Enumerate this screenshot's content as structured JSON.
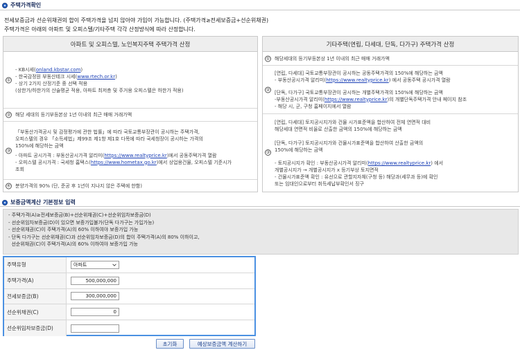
{
  "section1": {
    "title": "주택가격확인",
    "intro_line1": "전세보증금과 선순위채권의 합이 주택가격을 넘지 않아야 가입이 가능합니다. (주택가격≥전세보증금+선순위채권)",
    "intro_line2": "주택가격은 아래의 아파트 및 오피스텔/기타주택 각각 산정방식에 따라 산정합니다."
  },
  "left_panel": {
    "header": "아파트 및 오피스텔, 노인복지주택 주택가격 산정",
    "rows": [
      {
        "num": "①",
        "l1_prefix": "- KB시세(",
        "l1_link": "onland.kbstar.com",
        "l1_suffix": ")",
        "l2_prefix": "- 한국감정원 부동산테크 시세(",
        "l2_link": "www.rtech.or.kr",
        "l2_suffix": ")",
        "l3": "- 상기 2가지 산정기준 중 선택 적용",
        "l4": "(상한가/하한가의 산술평균 적용, 아파트 최저층 및 주거용 오피스텔은 하한가 적용)"
      },
      {
        "num": "②",
        "text": "해당 세대의 등기부등본상 1년 이내의 최근 매매 거래가액"
      },
      {
        "num": "③",
        "l1": "「부동산가격공시 및 감정평가에 관한 법률」에 따라 국토교통부장관이 공시하는 주택가격,",
        "l2": "오피스텔의 경우 「소득세법」제99조 제1항 제1호 다목에 따라 국세청장이 공시하는 가격의",
        "l3": "150%에 해당하는 금액",
        "l4_prefix": "- 아파트 공시가격 : 부동산공시가격 알리미(",
        "l4_link": "https://www.realtyprice.kr",
        "l4_suffix": ")에서 공동주택가격 열람",
        "l5_prefix": "- 오피스텔 공시가격 : 국세청 홈택스(",
        "l5_link": "https://www.hometax.go.kr",
        "l5_suffix": ")에서 상업용건물, 오피스텔 기준시가",
        "l6": "조회"
      },
      {
        "num": "④",
        "text": "분양가격의 90% (단, 준공 후 1년이 지나지 않은 주택에 한함)"
      }
    ]
  },
  "right_panel": {
    "header": "기타주택(연립, 다세대, 단독, 다가구) 주택가격 산정",
    "rows": [
      {
        "num": "①",
        "text": "해당세대의 등기부등본상 1년 이내의 최근 매매 거래가액"
      },
      {
        "num": "②",
        "a1": "[연립, 다세대] 국토교통부장관이 공시하는 공동주택가격의 150%에 해당하는 금액",
        "a2_prefix": "- 부동산공시가격 알리미(",
        "a2_link": "https://www.realtyprice.kr",
        "a2_suffix": ") 에서 공동주택 공시가격 열람",
        "b1": "[단독, 다가구] 국토교통부장관이 공시하는 개별주택가격의 150%에 해당하는 금액",
        "b2_prefix": "-부동산공시가격 알리미(",
        "b2_link": "https://www.realtyprice.kr",
        "b2_suffix": ")의 개별단독주택가격 안내 페이지 참조",
        "b3": "- 해당 시, 군, 구청 홈페이지에서 열람"
      },
      {
        "num": "③",
        "a1": "[연립, 다세대] 토지공시지가와 건물 시가표준액을 합산하여 전체 연면적 대비",
        "a2": "해당세대 연면적 비율로 산출한 금액의 150%에 해당하는 금액",
        "b1": "[단독, 다가구] 토지공시지가와 건물시가표준액을 합산하여 산출한 금액의",
        "b2": "150%에 해당하는 금액",
        "c1_prefix": "- 토지공시지가 확인 : 부동산공시가격 알리미(",
        "c1_link": "https://www.realtyprice.kr",
        "c1_suffix": ") 에서",
        "c2": "개별공시지가 → 개별공시지가 x 등기부상 토지면적",
        "c3": "- 건물시가표준액 확인 : 유선으로 관할지자체(구청 등) 해당과(세무과 등)에 확인",
        "c4": "또는 임대인으로부터 취득세납부확인서 징구"
      }
    ]
  },
  "section2": {
    "title": "보증금액계산 기본정보 입력"
  },
  "info_box": {
    "lines": [
      "- 주택가격(A)≥전세보증금(B)+선순위채권(C)+선순위임차보증금(D)",
      "- 선순위임차보증금(D)이 있으면 보증가입불가(단독 다가구는 가입가능)",
      "- 선순위채권(C)이 주택가격(A)의 60% 이하여야 보증가입 가능",
      "- 단독 다가구는 선순위채권(C)과 선순위임차보증금(D)의 합이 주택가격(A)의 80% 이하이고,",
      "  선순위채권(C)이 주택가격(A)의 60% 이하여야 보증가입 가능"
    ]
  },
  "form": {
    "house_type_label": "주택유형",
    "house_type_value": "아파트",
    "house_price_label": "주택가격(A)",
    "house_price_value": "500,000,000",
    "deposit_label": "전세보증금(B)",
    "deposit_value": "300,000,000",
    "senior_debt_label": "선순위채권(C)",
    "senior_debt_value": "0",
    "senior_deposit_label": "선순위임차보증금(D)",
    "senior_deposit_value": ""
  },
  "buttons": {
    "reset": "초기화",
    "calculate": "예상보증금액 계산하기"
  }
}
